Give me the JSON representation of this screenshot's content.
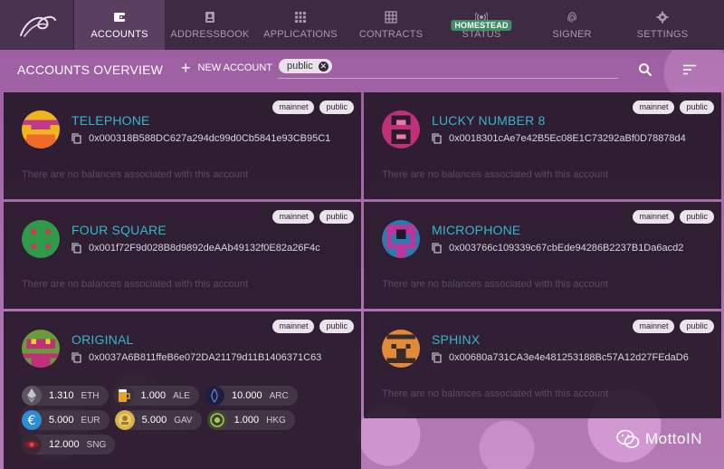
{
  "nav": {
    "items": [
      {
        "label": "ACCOUNTS",
        "icon": "wallet-icon",
        "active": true
      },
      {
        "label": "ADDRESSBOOK",
        "icon": "addressbook-icon",
        "active": false
      },
      {
        "label": "APPLICATIONS",
        "icon": "grid-icon",
        "active": false
      },
      {
        "label": "CONTRACTS",
        "icon": "table-icon",
        "active": false
      },
      {
        "label": "STATUS",
        "icon": "signal-icon",
        "active": false,
        "badge": "HOMESTEAD"
      },
      {
        "label": "SIGNER",
        "icon": "fingerprint-icon",
        "active": false
      },
      {
        "label": "SETTINGS",
        "icon": "gear-icon",
        "active": false
      }
    ]
  },
  "subheader": {
    "title": "ACCOUNTS OVERVIEW",
    "new_account": "NEW ACCOUNT",
    "filter_chip": "public"
  },
  "accounts": [
    {
      "name": "TELEPHONE",
      "address": "0x000318B588DC627a294dc99d0Cb5841e93CB95C1",
      "tags": [
        "mainnet",
        "public"
      ],
      "no_balance": "There are no balances associated with this account"
    },
    {
      "name": "LUCKY NUMBER 8",
      "address": "0x0018301cAe7e42B5Ec08E1C73292aBf0D78878d4",
      "tags": [
        "mainnet",
        "public"
      ],
      "no_balance": "There are no balances associated with this account"
    },
    {
      "name": "FOUR SQUARE",
      "address": "0x001f72F9d028B8d9892deAAb49132f0E82a26F4c",
      "tags": [
        "mainnet",
        "public"
      ],
      "no_balance": "There are no balances associated with this account"
    },
    {
      "name": "MICROPHONE",
      "address": "0x003766c109339c67cbEde94286B2237B1Da6acd2",
      "tags": [
        "mainnet",
        "public"
      ],
      "no_balance": "There are no balances associated with this account"
    },
    {
      "name": "ORIGINAL",
      "address": "0x0037A6B811ffeB6e072DA21179d11B1406371C63",
      "tags": [
        "mainnet",
        "public"
      ]
    },
    {
      "name": "SPHINX",
      "address": "0x00680a731CA3e4e481253188Bc57A12d27FEdaD6",
      "tags": [
        "mainnet",
        "public"
      ],
      "no_balance": "There are no balances associated with this account"
    }
  ],
  "balances": [
    {
      "amount": "1.310",
      "symbol": "ETH",
      "icon": "ethereum-icon",
      "color": "#5a5560"
    },
    {
      "amount": "1.000",
      "symbol": "ALE",
      "icon": "beer-icon",
      "color": "#e6a22a"
    },
    {
      "amount": "10.000",
      "symbol": "ARC",
      "icon": "arc-icon",
      "color": "#1c1f3e"
    },
    {
      "amount": "5.000",
      "symbol": "EUR",
      "icon": "euro-icon",
      "color": "#2a8fd6"
    },
    {
      "amount": "5.000",
      "symbol": "GAV",
      "icon": "gav-coin-icon",
      "color": "#d8b447"
    },
    {
      "amount": "1.000",
      "symbol": "HKG",
      "icon": "hkg-icon",
      "color": "#3a4a2a"
    },
    {
      "amount": "12.000",
      "symbol": "SNG",
      "icon": "sng-eye-icon",
      "color": "#8a1f2a"
    }
  ],
  "watermark": "MottoIN"
}
